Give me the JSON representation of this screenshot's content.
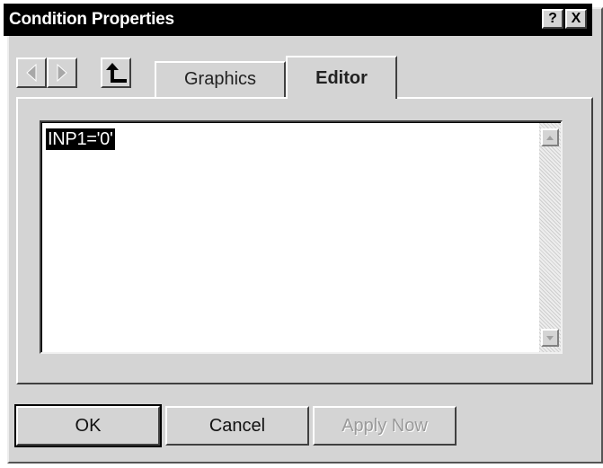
{
  "window": {
    "title": "Condition Properties",
    "help_label": "?",
    "close_label": "X"
  },
  "navigation": {
    "back_icon": "triangle-left-icon",
    "forward_icon": "triangle-right-icon",
    "up_icon": "up-level-arrow-icon"
  },
  "tabs": [
    {
      "label": "Graphics",
      "selected": false
    },
    {
      "label": "Editor",
      "selected": true
    }
  ],
  "editor": {
    "content": "INP1='0'",
    "selected": true
  },
  "buttons": {
    "ok_label": "OK",
    "cancel_label": "Cancel",
    "apply_label": "Apply Now",
    "apply_enabled": false
  },
  "colors": {
    "title_bar": "#000000",
    "dialog_face": "#d4d4d4",
    "selection_bg": "#000000"
  }
}
